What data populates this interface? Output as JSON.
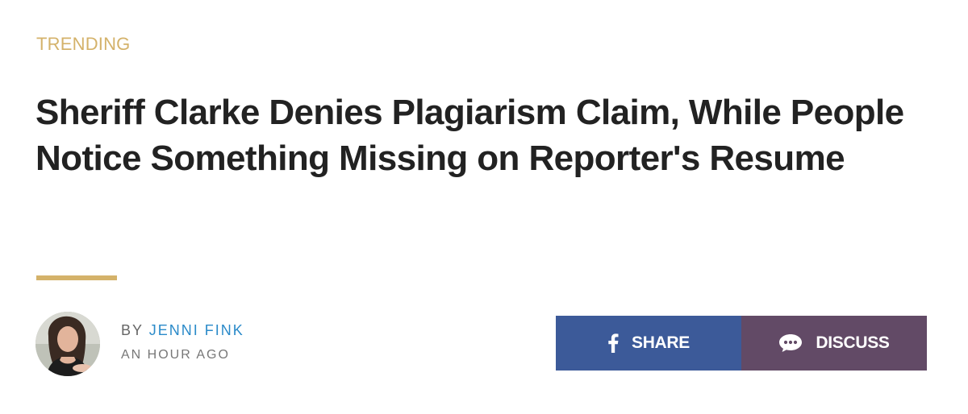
{
  "article": {
    "category": "TRENDING",
    "headline": "Sheriff Clarke Denies Plagiarism Claim, While People Notice Something Missing on Reporter's Resume",
    "byline_prefix": "BY ",
    "author": "JENNI FINK",
    "timestamp": "AN HOUR AGO"
  },
  "actions": {
    "share_label": "SHARE",
    "discuss_label": "DISCUSS"
  },
  "icons": {
    "share": "facebook-icon",
    "discuss": "speech-bubble-icon",
    "avatar": "author-photo"
  },
  "colors": {
    "accent": "#d4b26a",
    "headline": "#222222",
    "author_link": "#2a8ac9",
    "share_bg": "#3c5a99",
    "discuss_bg": "#624a66"
  }
}
